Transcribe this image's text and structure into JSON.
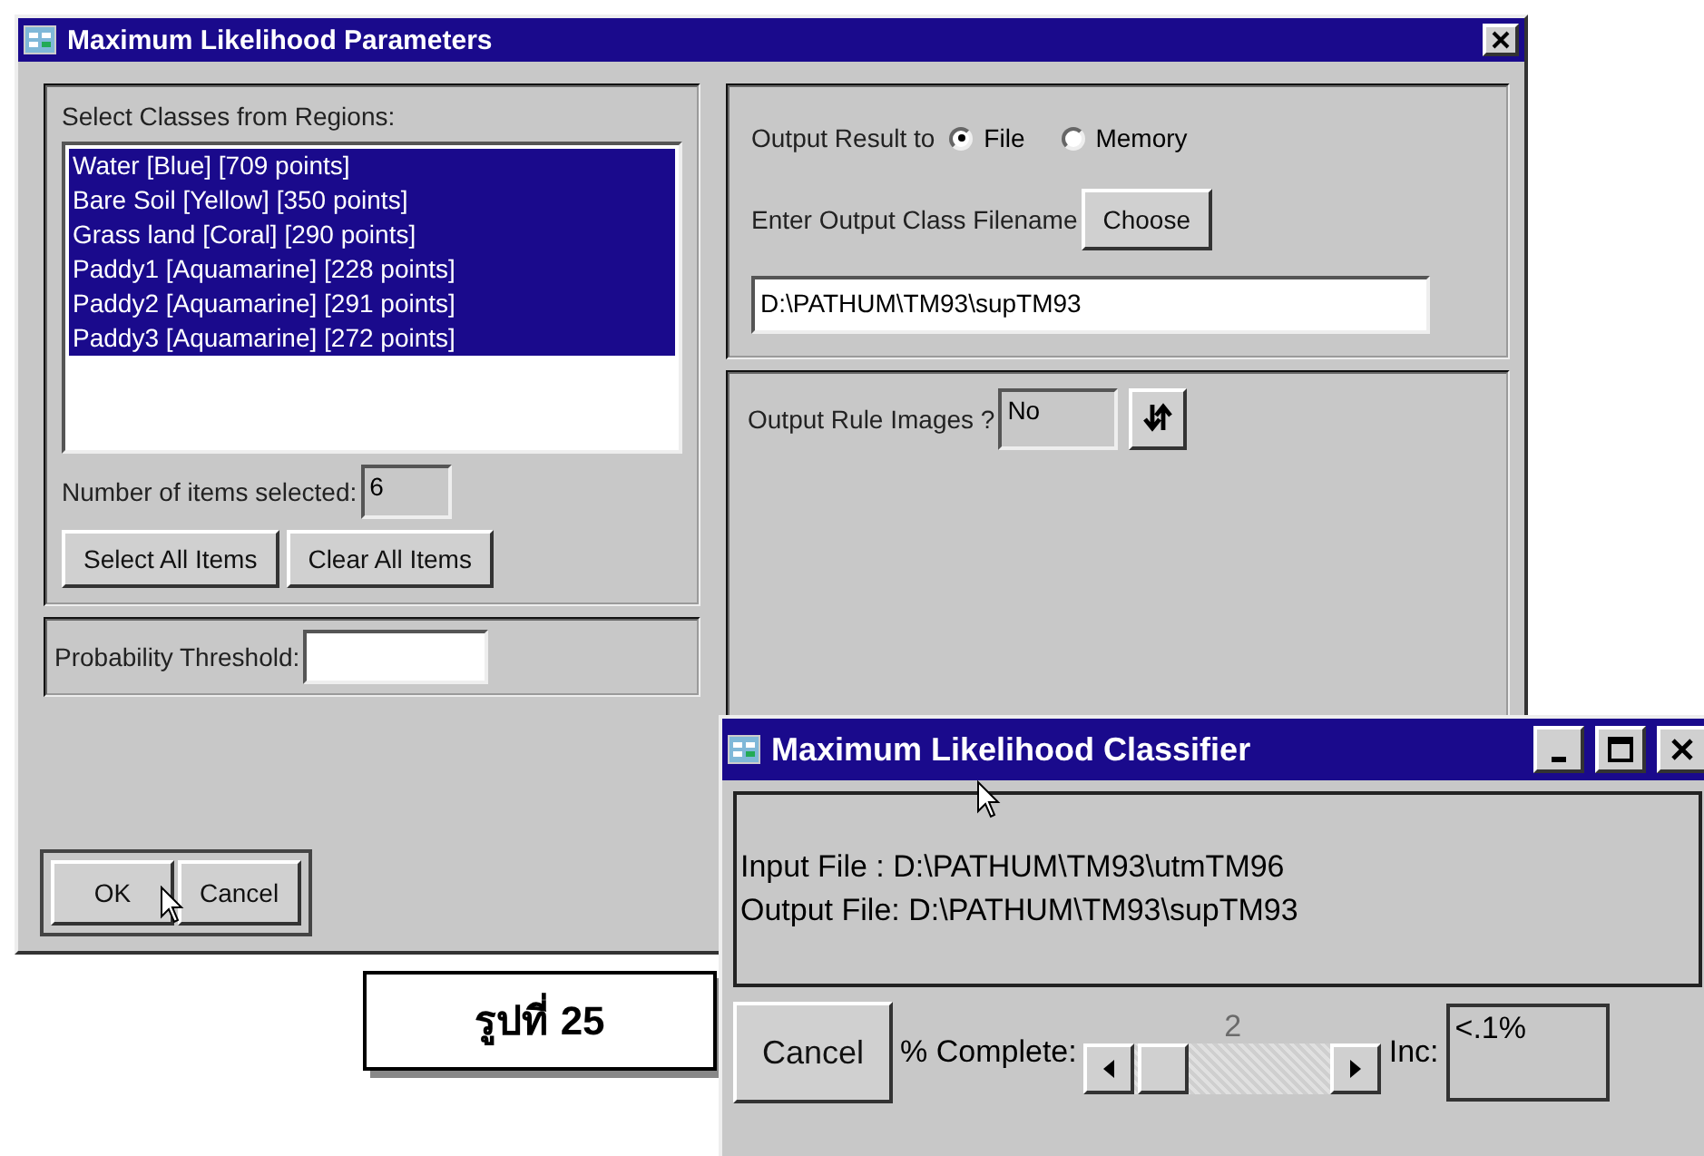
{
  "dialog": {
    "title": "Maximum Likelihood Parameters",
    "classes_label": "Select Classes from Regions:",
    "classes": [
      {
        "label": "Water [Blue] [709 points]",
        "selected": true
      },
      {
        "label": "Bare Soil [Yellow] [350 points]",
        "selected": true
      },
      {
        "label": "Grass land [Coral] [290 points]",
        "selected": true
      },
      {
        "label": "Paddy1 [Aquamarine] [228 points]",
        "selected": true
      },
      {
        "label": "Paddy2 [Aquamarine] [291 points]",
        "selected": true
      },
      {
        "label": "Paddy3 [Aquamarine] [272 points]",
        "selected": true
      }
    ],
    "count_label": "Number of items selected:",
    "count": "6",
    "select_all": "Select All Items",
    "clear_all": "Clear All Items",
    "threshold_label": "Probability Threshold:",
    "output_label": "Output Result to",
    "output_options": [
      {
        "label": "File",
        "selected": true
      },
      {
        "label": "Memory",
        "selected": false
      }
    ],
    "filename_label": "Enter Output Class Filename",
    "choose": "Choose",
    "filename": "D:\\PATHUM\\TM93\\supTM93",
    "rule_label": "Output Rule Images ?",
    "rule_value": "No",
    "ok": "OK",
    "cancel": "Cancel"
  },
  "progress": {
    "title": "Maximum Likelihood Classifier",
    "lines": [
      "Input File : D:\\PATHUM\\TM93\\utmTM96",
      "Output File: D:\\PATHUM\\TM93\\supTM93"
    ],
    "cancel": "Cancel",
    "complete_label": "% Complete:",
    "slider": {
      "reading": "2",
      "level": 0.02
    },
    "inc_label": "Inc:",
    "inc_value": "<.1%"
  },
  "caption": "รูปที่ 25"
}
